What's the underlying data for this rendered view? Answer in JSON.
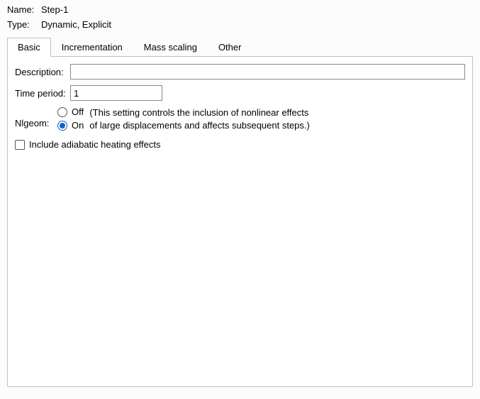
{
  "header": {
    "name_label": "Name:",
    "name_value": "Step-1",
    "type_label": "Type:",
    "type_value": "Dynamic, Explicit"
  },
  "tabs": {
    "basic": "Basic",
    "incrementation": "Incrementation",
    "mass_scaling": "Mass scaling",
    "other": "Other"
  },
  "basic_tab": {
    "description_label": "Description:",
    "description_value": "",
    "time_period_label": "Time period:",
    "time_period_value": "1",
    "nlgeom_label": "Nlgeom:",
    "nlgeom_off": "Off",
    "nlgeom_on": "On",
    "nlgeom_selected": "On",
    "nlgeom_hint_line1": "(This setting controls the inclusion of nonlinear effects",
    "nlgeom_hint_line2": "of large displacements and affects subsequent steps.)",
    "adiabatic_label": "Include adiabatic heating effects",
    "adiabatic_checked": false
  }
}
